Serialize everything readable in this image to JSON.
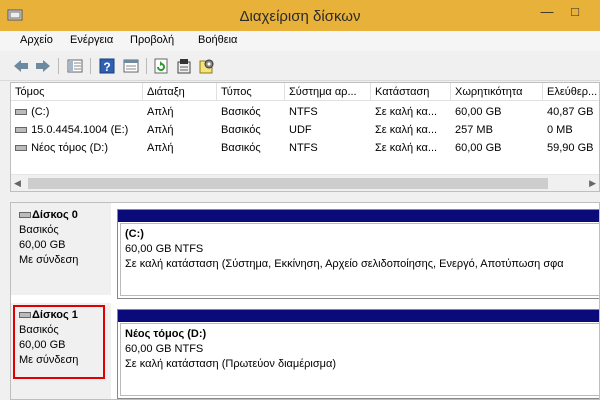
{
  "window": {
    "title": "Διαχείριση δίσκων"
  },
  "menu": [
    "Αρχείο",
    "Ενέργεια",
    "Προβολή",
    "Βοήθεια"
  ],
  "toolbar": {
    "icons": [
      "back-arrow-icon",
      "forward-arrow-icon",
      "pane-icon",
      "help-icon",
      "properties-icon",
      "refresh-icon",
      "properties-sheet-icon",
      "settings-icon"
    ]
  },
  "volume_list": {
    "columns": [
      "Τόμος",
      "Διάταξη",
      "Τύπος",
      "Σύστημα αρ...",
      "Κατάσταση",
      "Χωρητικότητα",
      "Ελεύθερ..."
    ],
    "rows": [
      [
        "(C:)",
        "Απλή",
        "Βασικός",
        "NTFS",
        "Σε καλή κα...",
        "60,00 GB",
        "40,87 GB"
      ],
      [
        "15.0.4454.1004 (E:)",
        "Απλή",
        "Βασικός",
        "UDF",
        "Σε καλή κα...",
        "257 MB",
        "0 MB"
      ],
      [
        "Νέος τόμος (D:)",
        "Απλή",
        "Βασικός",
        "NTFS",
        "Σε καλή κα...",
        "60,00 GB",
        "59,90 GB"
      ]
    ]
  },
  "disks": [
    {
      "name": "Δίσκος 0",
      "type": "Βασικός",
      "size": "60,00 GB",
      "status": "Με σύνδεση",
      "partition": {
        "name": "(C:)",
        "size_fs": "60,00 GB NTFS",
        "status": "Σε καλή κατάσταση (Σύστημα, Εκκίνηση, Αρχείο σελιδοποίησης, Ενεργό, Αποτύπωση σφα"
      }
    },
    {
      "name": "Δίσκος 1",
      "type": "Βασικός",
      "size": "60,00 GB",
      "status": "Με σύνδεση",
      "partition": {
        "name": "Νέος τόμος  (D:)",
        "size_fs": "60,00 GB NTFS",
        "status": "Σε καλή κατάσταση (Πρωτεύον διαμέρισμα)"
      }
    }
  ],
  "colors": {
    "titlebar": "#e8b23a",
    "partition_bar": "#0a0a7a",
    "highlight": "#e00000"
  }
}
